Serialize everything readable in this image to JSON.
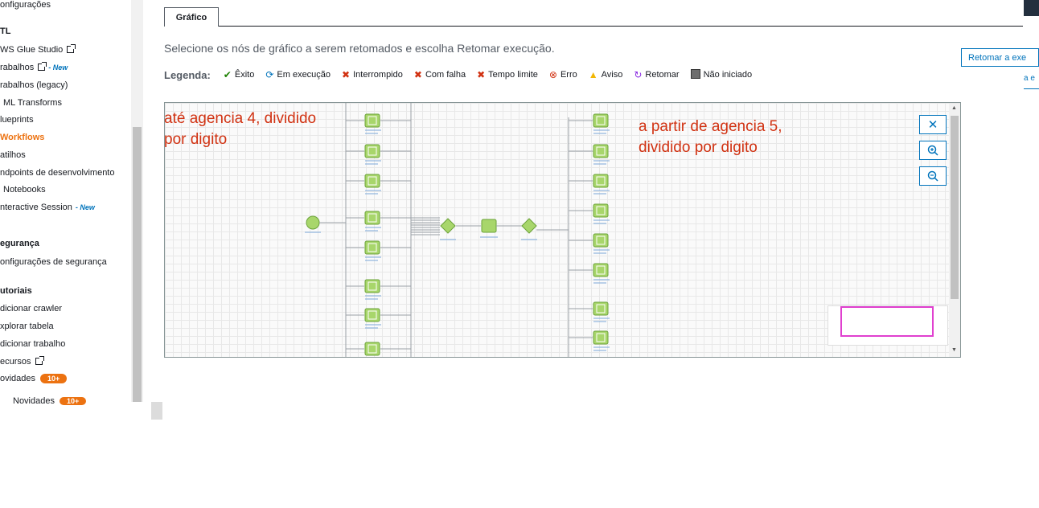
{
  "sidebar": {
    "items": [
      {
        "label": "onfigurações",
        "top": 0
      },
      {
        "label": "TL",
        "head": true
      },
      {
        "label": "WS Glue Studio",
        "ext": true
      },
      {
        "label": "rabalhos",
        "ext": true,
        "new": "- New"
      },
      {
        "label": "rabalhos (legacy)"
      },
      {
        "label": "ML Transforms"
      },
      {
        "label": "lueprints"
      },
      {
        "label": "Workflows",
        "active": true
      },
      {
        "label": "atilhos"
      },
      {
        "label": "ndpoints de desenvolvimento"
      },
      {
        "label": "Notebooks"
      },
      {
        "label": "nteractive Session",
        "new": "- New"
      },
      {
        "label": "egurança",
        "head": true
      },
      {
        "label": "onfigurações de segurança"
      },
      {
        "label": "utoriais",
        "head": true
      },
      {
        "label": "dicionar crawler"
      },
      {
        "label": "xplorar tabela"
      },
      {
        "label": "dicionar trabalho"
      },
      {
        "label": "ecursos",
        "ext": true
      },
      {
        "label": "ovidades",
        "badge": "10+"
      }
    ],
    "ghost_label": "Novidades",
    "ghost_badge": "10+"
  },
  "tab": {
    "label": "Gráfico"
  },
  "instruction": "Selecione os nós de gráfico a serem retomados e escolha Retomar execução.",
  "legend": {
    "title": "Legenda:",
    "items": [
      {
        "label": "Êxito",
        "icon": "check-icon",
        "color": "#1d8102"
      },
      {
        "label": "Em execução",
        "icon": "refresh-icon",
        "color": "#0073bb"
      },
      {
        "label": "Interrompido",
        "icon": "x-icon",
        "color": "#d13212"
      },
      {
        "label": "Com falha",
        "icon": "x-icon",
        "color": "#d13212"
      },
      {
        "label": "Tempo limite",
        "icon": "x-icon",
        "color": "#d13212"
      },
      {
        "label": "Erro",
        "icon": "error-circle-icon",
        "color": "#d13212"
      },
      {
        "label": "Aviso",
        "icon": "warning-icon",
        "color": "#f2b705"
      },
      {
        "label": "Retomar",
        "icon": "resume-icon",
        "color": "#8a2be2"
      },
      {
        "label": "Não iniciado",
        "icon": "square-icon",
        "color": "#6d6d6d"
      }
    ]
  },
  "resume_button": {
    "label": "Retomar a exe"
  },
  "resume_sub": "a e",
  "annotations": {
    "left_line1": "até agencia 4, dividido",
    "left_line2": "por digito",
    "right_line1": "a partir de agencia 5,",
    "right_line2": "dividido por digito"
  },
  "controls": {
    "close": "close-icon",
    "zoom_in": "zoom-in-icon",
    "zoom_out": "zoom-out-icon"
  },
  "colors": {
    "accent": "#ec7211",
    "link": "#0073bb",
    "annotation": "#d13212",
    "node": "#a8d66b"
  }
}
